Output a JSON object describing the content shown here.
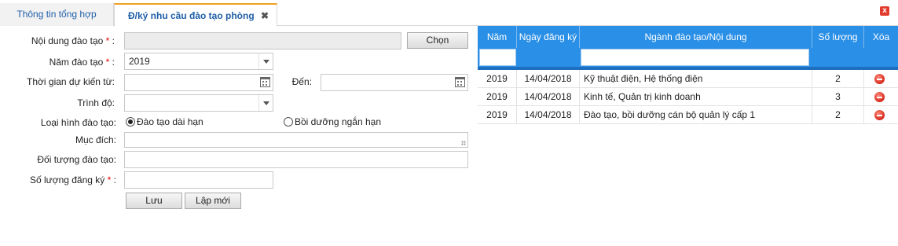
{
  "tabs": [
    {
      "label": "Thông tin tổng hợp"
    },
    {
      "label": "Đ/ký nhu cầu đào tạo phòng",
      "close": "✖"
    }
  ],
  "window": {
    "close": "x"
  },
  "form": {
    "noi_dung": {
      "label": "Nội dung đào tạo",
      "required": "*",
      "colon": ":",
      "value": "",
      "button": "Chọn"
    },
    "nam": {
      "label": "Năm đào tạo",
      "required": "*",
      "colon": ":",
      "value": "2019"
    },
    "thoi_gian": {
      "label": "Thời gian dự kiến từ:",
      "value": ""
    },
    "den": {
      "label": "Đến:",
      "value": ""
    },
    "trinh_do": {
      "label": "Trình độ:",
      "value": ""
    },
    "loai_hinh": {
      "label": "Loại hình đào tạo:",
      "options": [
        {
          "label": "Đào tạo dài hạn",
          "selected": true
        },
        {
          "label": "Bồi dưỡng ngắn hạn",
          "selected": false
        }
      ]
    },
    "muc_dich": {
      "label": "Mục đích:",
      "value": ""
    },
    "doi_tuong": {
      "label": "Đối tượng đào tạo:",
      "value": ""
    },
    "so_luong": {
      "label": "Số lượng đăng ký",
      "required": "*",
      "colon": ":",
      "value": ""
    },
    "save_label": "Lưu",
    "reset_label": "Lập mới"
  },
  "grid": {
    "columns": [
      "Năm",
      "Ngày đăng ký",
      "Ngành đào tạo/Nội dung",
      "Số lượng",
      "Xóa"
    ],
    "rows": [
      {
        "nam": "2019",
        "ngay": "14/04/2018",
        "nganh": "Kỹ thuật điện, Hệ thống điện",
        "so_luong": "2"
      },
      {
        "nam": "2019",
        "ngay": "14/04/2018",
        "nganh": "Kinh tế, Quản trị kinh doanh",
        "so_luong": "3"
      },
      {
        "nam": "2019",
        "ngay": "14/04/2018",
        "nganh": "Đào tạo, bồi dưỡng cán bộ quản lý cấp 1",
        "so_luong": "2"
      }
    ]
  },
  "colors": {
    "header_blue": "#2a8fe6",
    "accent_orange": "#f0a020",
    "tab_text": "#1f5fa8",
    "required_red": "#dd0000"
  }
}
